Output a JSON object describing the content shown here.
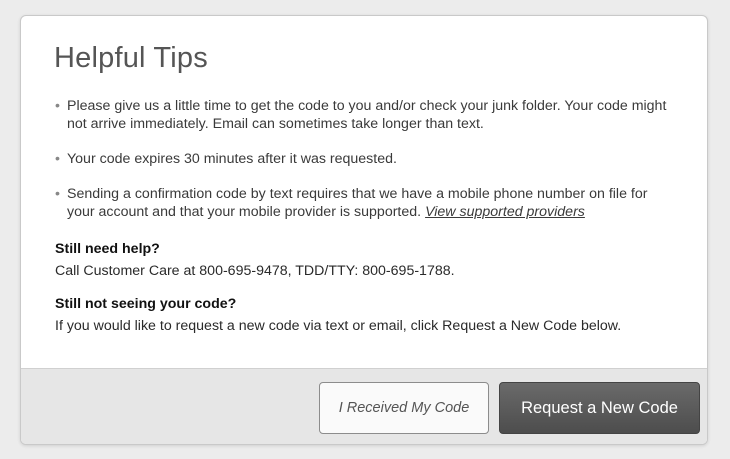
{
  "dialog": {
    "title": "Helpful Tips",
    "tips": [
      {
        "text": "Please give us a little time to get the code to you and/or check your junk folder. Your code might not arrive immediately. Email can sometimes take longer than text."
      },
      {
        "text": "Your code expires 30 minutes after it was requested."
      },
      {
        "text": "Sending a confirmation code by text requires that we have a mobile phone number on file for your account and that your mobile provider is supported.",
        "link_text": "View supported providers"
      }
    ],
    "bullet_char": "•",
    "still_need_help": {
      "heading": "Still need help?",
      "body": "Call Customer Care at 800-695-9478, TDD/TTY: 800-695-1788."
    },
    "still_not_seeing": {
      "heading": "Still not seeing your code?",
      "body": "If you would like to request a new code via text or email, click Request a New Code below."
    }
  },
  "footer": {
    "received_button_label": "I Received My Code",
    "request_button_label": "Request a New Code"
  },
  "colors": {
    "page_background": "#ececec",
    "dialog_background": "#ffffff",
    "footer_background": "#e6e6e6",
    "primary_button": "#555555"
  }
}
